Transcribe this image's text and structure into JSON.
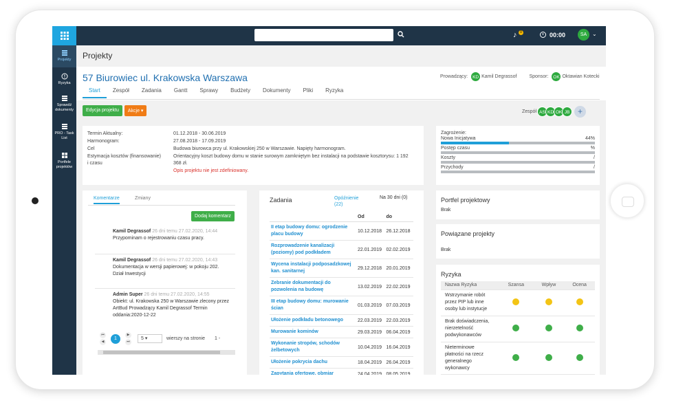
{
  "topbar": {
    "timer": "00:00",
    "user_initials": "SA",
    "notif_count": "0"
  },
  "sidebar": {
    "items": [
      {
        "label": "Projekty",
        "icon": "projects-icon"
      },
      {
        "label": "Ryzyka",
        "icon": "alert-icon"
      },
      {
        "label": "Sprawdź dokumenty",
        "icon": "documents-icon"
      },
      {
        "label": "PRO - Task List",
        "icon": "tasklist-icon"
      },
      {
        "label": "Portfele projektów",
        "icon": "portfolio-icon"
      }
    ]
  },
  "page_title": "Projekty",
  "project": {
    "title": "57 Biurowiec ul. Krakowska Warszawa",
    "lead_label": "Prowadzący:",
    "lead_initials": "KD",
    "lead_name": "Kamil Degrassof",
    "sponsor_label": "Sponsor:",
    "sponsor_initials": "OK",
    "sponsor_name": "Oktawian Kotecki"
  },
  "tabs": [
    "Start",
    "Zespół",
    "Zadania",
    "Gantt",
    "Sprawy",
    "Budżety",
    "Dokumenty",
    "Pliki",
    "Ryzyka"
  ],
  "buttons": {
    "edit": "Edycja projektu",
    "actions": "Akcje ▾"
  },
  "team": {
    "label": "Zespół",
    "members": [
      "AS",
      "KD",
      "OK",
      "JB"
    ],
    "add": "+"
  },
  "info": {
    "term_label": "Termin Aktualny:",
    "term_value": "01.12.2018 - 30.06.2019",
    "harm_label": "Harmonogram:",
    "harm_value": "27.08.2018 - 17.09.2019",
    "cel_label": "Cel",
    "cel_value": "Budowa biurowca przy ul. Krakowskiej 250 w Warszawie. Napięty harmonogram.",
    "est_label_1": "Estymacja kosztów (finansowanie)",
    "est_label_2": "i czasu",
    "est_value_1": "Orientacyjny koszt budowy domu w stanie surowym zamkniętym bez instalacji na podstawie kosztorysu: 1 192",
    "est_value_2": "368 zł.",
    "opis_missing": "Opis projektu nie jest zdefiniowany."
  },
  "threats": {
    "title": "Zagrożenie:",
    "rows": [
      {
        "label": "Nowa Inicjatywa",
        "value": "44%",
        "fill": 0.44
      },
      {
        "label": "Postęp czasu",
        "value": "%",
        "fill": 0
      },
      {
        "label": "Koszty",
        "value": "/",
        "fill": 0
      },
      {
        "label": "Przychody",
        "value": "/",
        "fill": 0
      }
    ]
  },
  "comments": {
    "tab_comments": "Komentarze",
    "tab_changes": "Zmiany",
    "add_button": "Dodaj komentarz",
    "items": [
      {
        "author": "Kamil Degrassof",
        "meta": "26 dni temu 27.02.2020, 14:44",
        "lines": [
          "Przypominam o rejestrowaniu czasu pracy."
        ]
      },
      {
        "author": "Kamil Degrassof",
        "meta": "26 dni temu 27.02.2020, 14:43",
        "lines": [
          "Dokumentacja w wersji papierowej: w pokoju 202.",
          "Dział Inwestycji"
        ]
      },
      {
        "author": "Admin Super",
        "meta": "26 dni temu 27.02.2020, 14:55",
        "lines": [
          "Obiekt: ul. Krakowska 250 w Warszawie zlecony przez",
          "ArtBud Prowadzący Kamil Degrassof Termin",
          "oddania:2020-12-22"
        ]
      }
    ],
    "pager": {
      "first": "⏮",
      "prev": "◀",
      "page": "1",
      "next": "▶",
      "last": "⏭",
      "per_page": "5",
      "per_page_label": "wierszy na stronie",
      "range": "1 -"
    }
  },
  "tasks": {
    "title": "Zadania",
    "delay": "Opóźnienie (22)",
    "next30": "Na 30 dni (0)",
    "col_from": "Od",
    "col_to": "do",
    "rows": [
      {
        "name": "II etap budowy domu: ogrodzenie placu budowy",
        "from": "10.12.2018",
        "to": "26.12.2018"
      },
      {
        "name": "Rozprowadzenie kanalizacji (poziomy) pod podkładem",
        "from": "22.01.2019",
        "to": "02.02.2019"
      },
      {
        "name": "Wycena instalacji podposadzkowej kan. sanitarnej",
        "from": "29.12.2018",
        "to": "20.01.2019"
      },
      {
        "name": "Zebranie dokumentacji do pozwolenia na budowę",
        "from": "13.02.2019",
        "to": "22.02.2019"
      },
      {
        "name": "III etap budowy domu: murowanie ścian",
        "from": "01.03.2019",
        "to": "07.03.2019"
      },
      {
        "name": "Ułożenie podkładu betonowego",
        "from": "22.03.2019",
        "to": "22.03.2019"
      },
      {
        "name": "Murowanie kominów",
        "from": "29.03.2019",
        "to": "06.04.2019"
      },
      {
        "name": "Wykonanie stropów, schodów żelbetowych",
        "from": "10.04.2019",
        "to": "16.04.2019"
      },
      {
        "name": "Ułożenie pokrycia dachu",
        "from": "18.04.2019",
        "to": "26.04.2019"
      },
      {
        "name": "Zapytania ofertowe, obmiar",
        "from": "24.04.2019",
        "to": "08.05.2019"
      }
    ]
  },
  "portfolio": {
    "title": "Portfel projektowy",
    "value": "Brak"
  },
  "related": {
    "title": "Powiązane projekty",
    "value": "Brak"
  },
  "risks": {
    "title": "Ryzyka",
    "headers": [
      "Nazwa Ryzyka",
      "Szansa",
      "Wpływ",
      "Ocena"
    ],
    "rows": [
      {
        "name": "Wstrzymanie robót przez PIP lub inne osoby lub instytucje",
        "szansa": "yellow",
        "wplyw": "yellow",
        "ocena": "yellow"
      },
      {
        "name": "Brak doświadczenia, nierzetelność podwykonawców",
        "szansa": "green",
        "wplyw": "green",
        "ocena": "green"
      },
      {
        "name": "Nieterminowe płatności na rzecz generalnego wykonawcy",
        "szansa": "green",
        "wplyw": "green",
        "ocena": "green"
      }
    ]
  },
  "colors": {
    "accent": "#1f9fd8",
    "nav": "#1f3447",
    "green": "#3fae49",
    "orange": "#f07c16",
    "yellow": "#f3c415"
  }
}
